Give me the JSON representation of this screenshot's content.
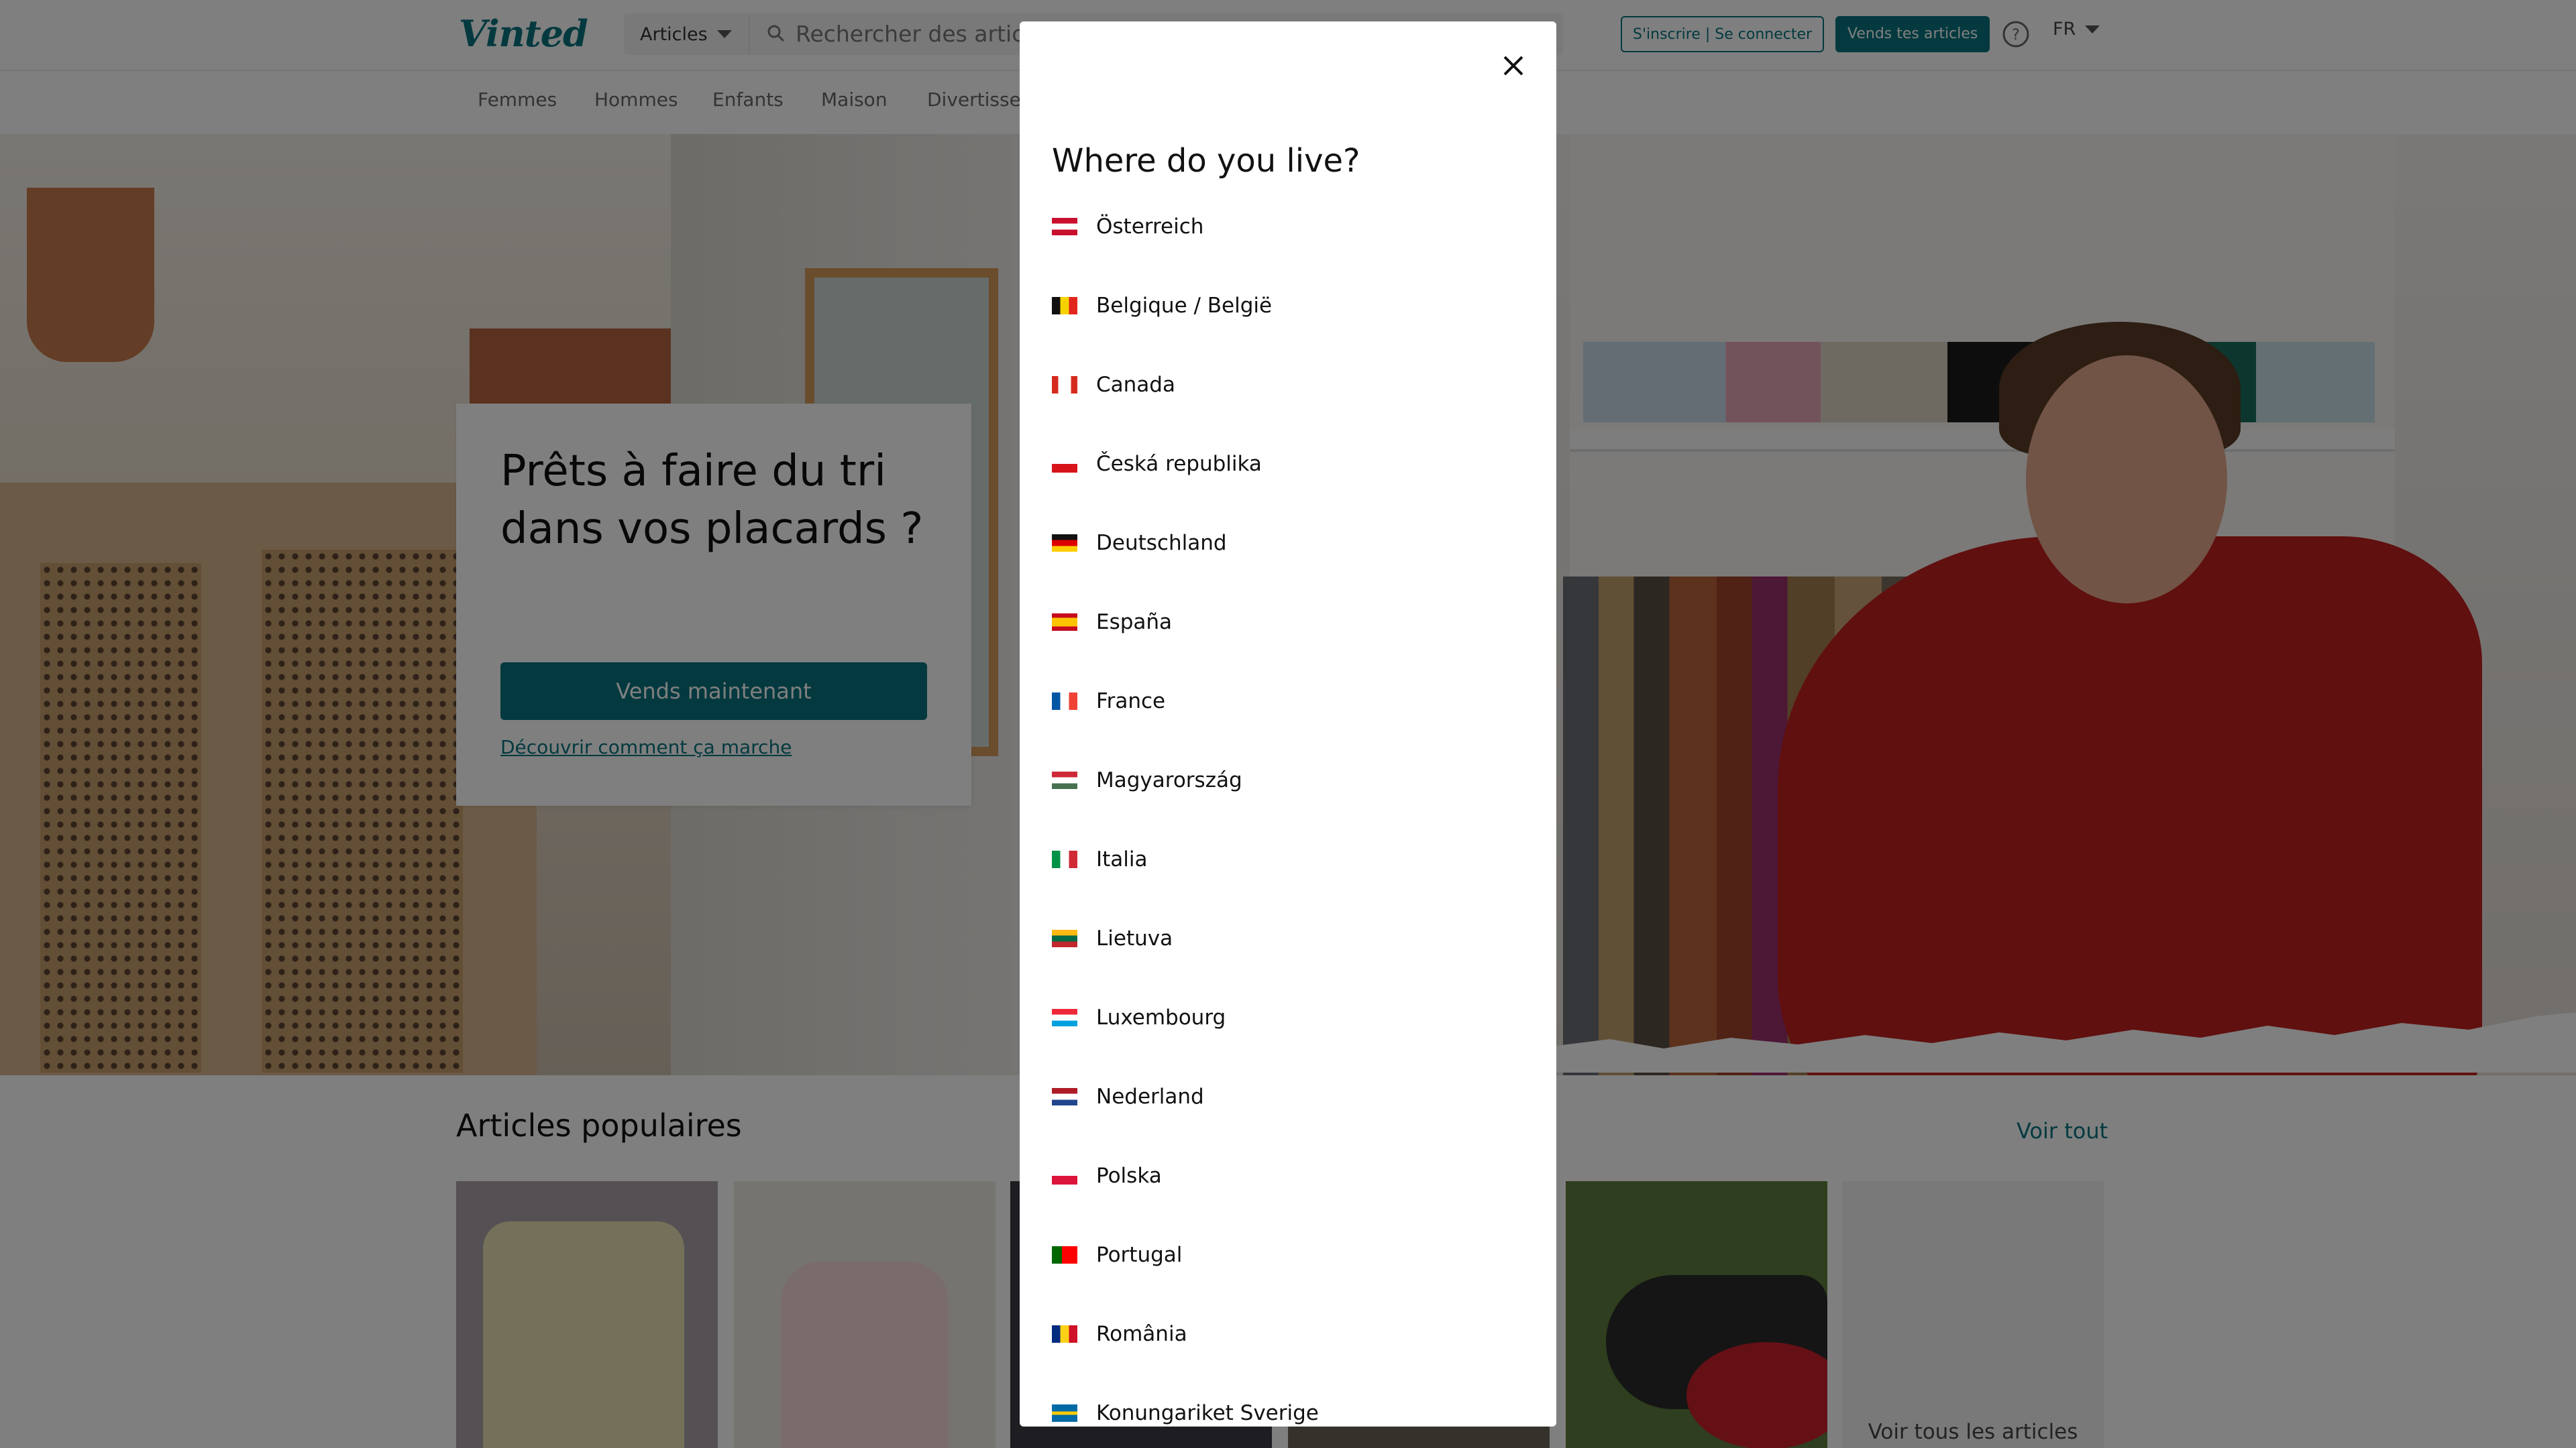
{
  "header": {
    "logo": "Vinted",
    "search_category": "Articles",
    "search_placeholder": "Rechercher des articles",
    "login_label": "S'inscrire | Se connecter",
    "sell_label": "Vends tes articles",
    "lang_label": "FR",
    "brand_color": "#09747e"
  },
  "nav": {
    "items": [
      {
        "label": "Femmes"
      },
      {
        "label": "Hommes"
      },
      {
        "label": "Enfants"
      },
      {
        "label": "Maison"
      },
      {
        "label": "Divertissement"
      }
    ]
  },
  "hero": {
    "title": "Prêts à faire du tri dans vos placards ?",
    "cta_label": "Vends maintenant",
    "link_label": "Découvrir comment ça marche"
  },
  "popular": {
    "title": "Articles populaires",
    "see_all": "Voir tout",
    "see_all_tile": "Voir tous les articles"
  },
  "modal": {
    "title": "Where do you live?",
    "countries": [
      {
        "label": "Österreich",
        "flag": "at"
      },
      {
        "label": "Belgique / België",
        "flag": "be"
      },
      {
        "label": "Canada",
        "flag": "ca"
      },
      {
        "label": "Česká republika",
        "flag": "cz"
      },
      {
        "label": "Deutschland",
        "flag": "de"
      },
      {
        "label": "España",
        "flag": "es"
      },
      {
        "label": "France",
        "flag": "fr"
      },
      {
        "label": "Magyarország",
        "flag": "hu"
      },
      {
        "label": "Italia",
        "flag": "it"
      },
      {
        "label": "Lietuva",
        "flag": "lt"
      },
      {
        "label": "Luxembourg",
        "flag": "lu"
      },
      {
        "label": "Nederland",
        "flag": "nl"
      },
      {
        "label": "Polska",
        "flag": "pl"
      },
      {
        "label": "Portugal",
        "flag": "pt"
      },
      {
        "label": "România",
        "flag": "ro"
      },
      {
        "label": "Konungariket Sverige",
        "flag": "se"
      }
    ]
  }
}
